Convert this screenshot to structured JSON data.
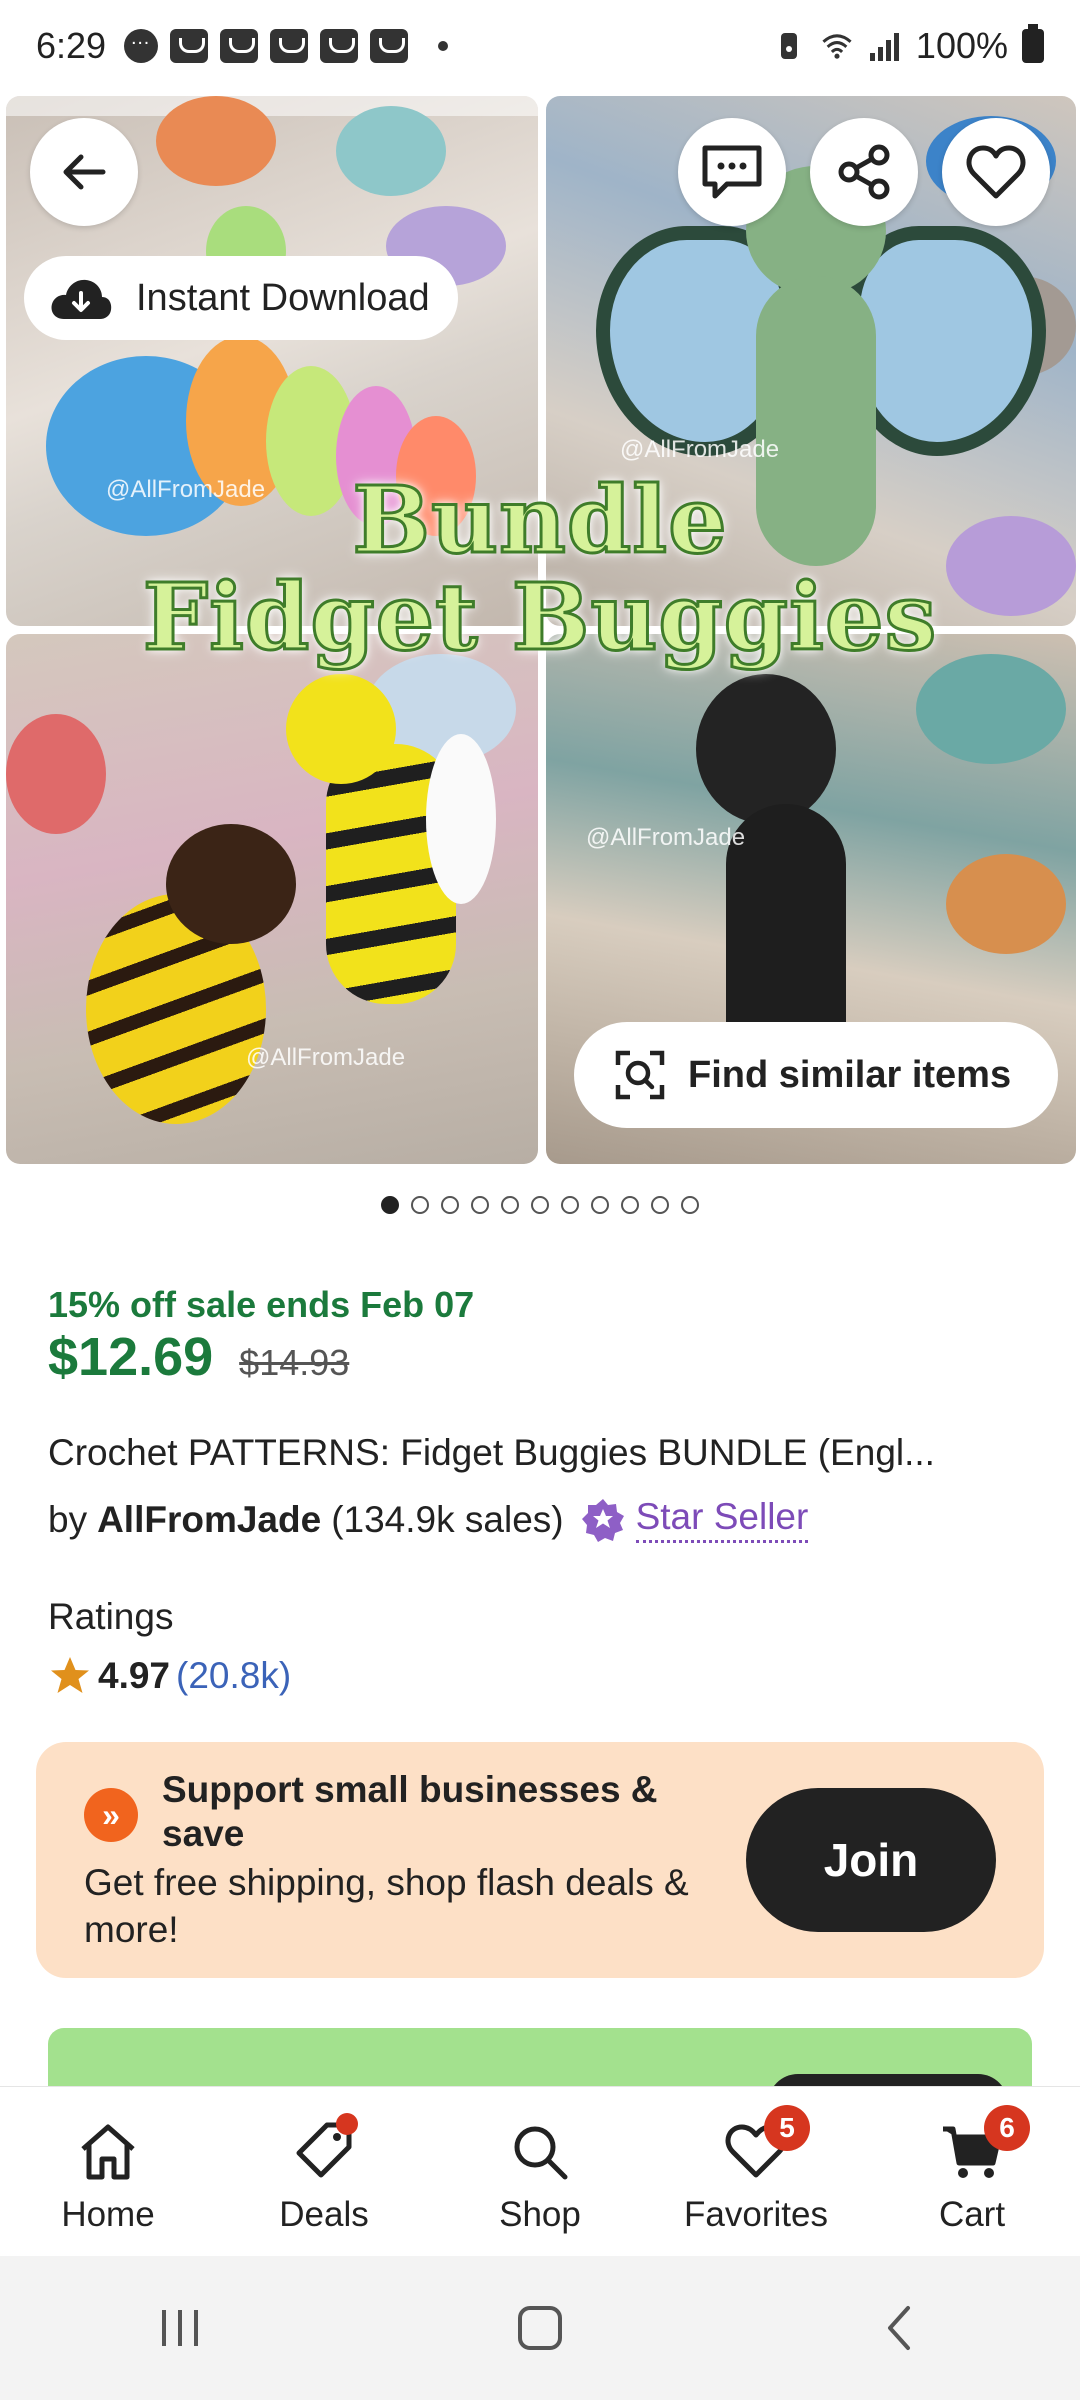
{
  "status_bar": {
    "time": "6:29",
    "battery": "100%"
  },
  "hero": {
    "title_line1": "Bundle",
    "title_line2": "Fidget Buggies",
    "watermark": "@AllFromJade",
    "instant_download_label": "Instant Download",
    "find_similar_label": "Find similar items",
    "image_count": 11,
    "active_image_index": 0
  },
  "listing": {
    "sale_text": "15% off sale ends Feb 07",
    "price": "$12.69",
    "original_price": "$14.93",
    "title": "Crochet PATTERNS: Fidget Buggies BUNDLE (Engl...",
    "by_label": "by",
    "shop_name": "AllFromJade",
    "sales": "(134.9k sales)",
    "star_seller_label": "Star Seller",
    "ratings_label": "Ratings",
    "rating_score": "4.97",
    "rating_count": "(20.8k)"
  },
  "promo": {
    "title": "Support small businesses & save",
    "subtitle": "Get free shipping, shop flash deals & more!",
    "join_label": "Join",
    "accent_color": "#f1641e",
    "background_color": "#fde0c6"
  },
  "bottom_nav": {
    "items": [
      {
        "label": "Home",
        "icon": "home-icon"
      },
      {
        "label": "Deals",
        "icon": "tag-icon",
        "badge_dot": true
      },
      {
        "label": "Shop",
        "icon": "search-icon"
      },
      {
        "label": "Favorites",
        "icon": "heart-icon",
        "badge": "5"
      },
      {
        "label": "Cart",
        "icon": "cart-icon",
        "badge": "6"
      }
    ]
  },
  "colors": {
    "sale_green": "#1b7a3c",
    "star_seller_purple": "#7d4bb8",
    "rating_count_blue": "#3b63b8",
    "badge_red": "#d6361f"
  }
}
